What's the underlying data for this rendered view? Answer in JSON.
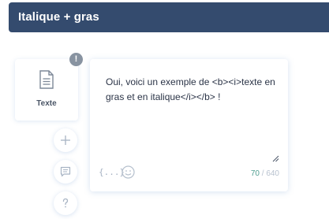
{
  "header": {
    "title": "Italique + gras"
  },
  "block": {
    "label": "Texte",
    "icon": "document-icon",
    "warning_badge": "!"
  },
  "editor": {
    "message": "Oui, voici un exemple de <b><i>texte en gras et en italique</i></b> !",
    "variable_icon": "{...}",
    "emoji_icon": "smiley-icon",
    "char_count": "70",
    "char_separator": " / ",
    "char_limit": "640"
  },
  "side_actions": [
    {
      "icon": "plus-icon"
    },
    {
      "icon": "comment-icon"
    },
    {
      "icon": "question-icon"
    }
  ],
  "colors": {
    "header_bg": "#344b6e",
    "counter_current": "#4f9e90",
    "badge_bg": "#8893a1"
  }
}
